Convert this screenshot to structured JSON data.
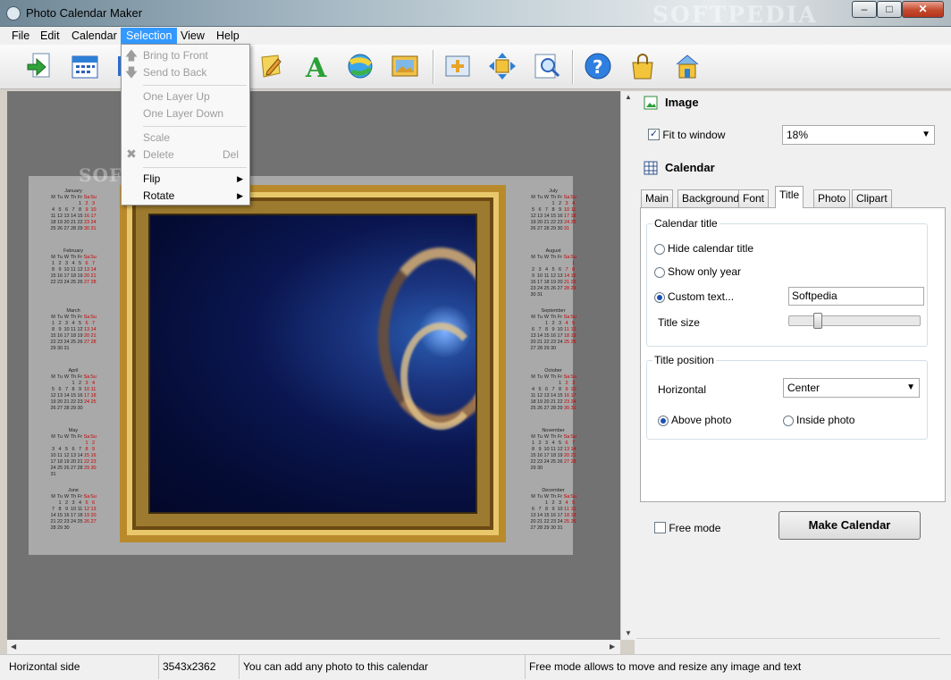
{
  "window": {
    "title": "Photo Calendar Maker",
    "watermark": "SOFTPEDIA",
    "buttons": {
      "min": "–",
      "max": "□",
      "close": "✕"
    }
  },
  "menu": [
    {
      "label": "File"
    },
    {
      "label": "Edit"
    },
    {
      "label": "Calendar"
    },
    {
      "label": "Selection",
      "active": true
    },
    {
      "label": "View"
    },
    {
      "label": "Help"
    }
  ],
  "selection_menu": {
    "items": [
      {
        "label": "Bring to Front",
        "enabled": false
      },
      {
        "label": "Send to Back",
        "enabled": false
      },
      {
        "label": "One Layer Up",
        "enabled": false
      },
      {
        "label": "One Layer Down",
        "enabled": false
      },
      {
        "label": "Scale",
        "enabled": false
      },
      {
        "label": "Delete",
        "enabled": false,
        "shortcut": "Del"
      },
      {
        "label": "Flip",
        "enabled": true,
        "submenu": true
      },
      {
        "label": "Rotate",
        "enabled": true,
        "submenu": true
      }
    ]
  },
  "toolbar": {
    "icons": [
      "open-photo-icon",
      "calendar-icon",
      "layout-icon",
      "note-icon",
      "text-icon",
      "ball-icon",
      "background-image-icon",
      "fit-icon",
      "move-icon",
      "zoom-icon",
      "help-icon",
      "buy-icon",
      "home-icon"
    ]
  },
  "canvas": {
    "watermark": "SOFTPEDIA",
    "months_left": [
      {
        "name": "January",
        "header": [
          "M",
          "Tu",
          "W",
          "Th",
          "Fr",
          "Sa",
          "Su"
        ],
        "weeks": [
          [
            "",
            "",
            "",
            "",
            "1",
            "2",
            "3"
          ],
          [
            "4",
            "5",
            "6",
            "7",
            "8",
            "9",
            "10"
          ],
          [
            "11",
            "12",
            "13",
            "14",
            "15",
            "16",
            "17"
          ],
          [
            "18",
            "19",
            "20",
            "21",
            "22",
            "23",
            "24"
          ],
          [
            "25",
            "26",
            "27",
            "28",
            "29",
            "30",
            "31"
          ]
        ]
      },
      {
        "name": "February",
        "header": [
          "M",
          "Tu",
          "W",
          "Th",
          "Fr",
          "Sa",
          "Su"
        ],
        "weeks": [
          [
            "1",
            "2",
            "3",
            "4",
            "5",
            "6",
            "7"
          ],
          [
            "8",
            "9",
            "10",
            "11",
            "12",
            "13",
            "14"
          ],
          [
            "15",
            "16",
            "17",
            "18",
            "19",
            "20",
            "21"
          ],
          [
            "22",
            "23",
            "24",
            "25",
            "26",
            "27",
            "28"
          ]
        ]
      },
      {
        "name": "March",
        "header": [
          "M",
          "Tu",
          "W",
          "Th",
          "Fr",
          "Sa",
          "Su"
        ],
        "weeks": [
          [
            "1",
            "2",
            "3",
            "4",
            "5",
            "6",
            "7"
          ],
          [
            "8",
            "9",
            "10",
            "11",
            "12",
            "13",
            "14"
          ],
          [
            "15",
            "16",
            "17",
            "18",
            "19",
            "20",
            "21"
          ],
          [
            "22",
            "23",
            "24",
            "25",
            "26",
            "27",
            "28"
          ],
          [
            "29",
            "30",
            "31",
            "",
            "",
            "",
            ""
          ]
        ]
      },
      {
        "name": "April",
        "header": [
          "M",
          "Tu",
          "W",
          "Th",
          "Fr",
          "Sa",
          "Su"
        ],
        "weeks": [
          [
            "",
            "",
            "",
            "1",
            "2",
            "3",
            "4"
          ],
          [
            "5",
            "6",
            "7",
            "8",
            "9",
            "10",
            "11"
          ],
          [
            "12",
            "13",
            "14",
            "15",
            "16",
            "17",
            "18"
          ],
          [
            "19",
            "20",
            "21",
            "22",
            "23",
            "24",
            "25"
          ],
          [
            "26",
            "27",
            "28",
            "29",
            "30",
            "",
            ""
          ]
        ]
      },
      {
        "name": "May",
        "header": [
          "M",
          "Tu",
          "W",
          "Th",
          "Fr",
          "Sa",
          "Su"
        ],
        "weeks": [
          [
            "",
            "",
            "",
            "",
            "",
            "1",
            "2"
          ],
          [
            "3",
            "4",
            "5",
            "6",
            "7",
            "8",
            "9"
          ],
          [
            "10",
            "11",
            "12",
            "13",
            "14",
            "15",
            "16"
          ],
          [
            "17",
            "18",
            "19",
            "20",
            "21",
            "22",
            "23"
          ],
          [
            "24",
            "25",
            "26",
            "27",
            "28",
            "29",
            "30"
          ],
          [
            "31",
            "",
            "",
            "",
            "",
            "",
            ""
          ]
        ]
      },
      {
        "name": "June",
        "header": [
          "M",
          "Tu",
          "W",
          "Th",
          "Fr",
          "Sa",
          "Su"
        ],
        "weeks": [
          [
            "",
            "1",
            "2",
            "3",
            "4",
            "5",
            "6"
          ],
          [
            "7",
            "8",
            "9",
            "10",
            "11",
            "12",
            "13"
          ],
          [
            "14",
            "15",
            "16",
            "17",
            "18",
            "19",
            "20"
          ],
          [
            "21",
            "22",
            "23",
            "24",
            "25",
            "26",
            "27"
          ],
          [
            "28",
            "29",
            "30",
            "",
            "",
            "",
            ""
          ]
        ]
      }
    ],
    "months_right": [
      {
        "name": "July",
        "header": [
          "M",
          "Tu",
          "W",
          "Th",
          "Fr",
          "Sa",
          "Su"
        ],
        "weeks": [
          [
            "",
            "",
            "",
            "1",
            "2",
            "3",
            "4"
          ],
          [
            "5",
            "6",
            "7",
            "8",
            "9",
            "10",
            "11"
          ],
          [
            "12",
            "13",
            "14",
            "15",
            "16",
            "17",
            "18"
          ],
          [
            "19",
            "20",
            "21",
            "22",
            "23",
            "24",
            "25"
          ],
          [
            "26",
            "27",
            "28",
            "29",
            "30",
            "31",
            ""
          ]
        ]
      },
      {
        "name": "August",
        "header": [
          "M",
          "Tu",
          "W",
          "Th",
          "Fr",
          "Sa",
          "Su"
        ],
        "weeks": [
          [
            "",
            "",
            "",
            "",
            "",
            "",
            "1"
          ],
          [
            "2",
            "3",
            "4",
            "5",
            "6",
            "7",
            "8"
          ],
          [
            "9",
            "10",
            "11",
            "12",
            "13",
            "14",
            "15"
          ],
          [
            "16",
            "17",
            "18",
            "19",
            "20",
            "21",
            "22"
          ],
          [
            "23",
            "24",
            "25",
            "26",
            "27",
            "28",
            "29"
          ],
          [
            "30",
            "31",
            "",
            "",
            "",
            "",
            ""
          ]
        ]
      },
      {
        "name": "September",
        "header": [
          "M",
          "Tu",
          "W",
          "Th",
          "Fr",
          "Sa",
          "Su"
        ],
        "weeks": [
          [
            "",
            "",
            "1",
            "2",
            "3",
            "4",
            "5"
          ],
          [
            "6",
            "7",
            "8",
            "9",
            "10",
            "11",
            "12"
          ],
          [
            "13",
            "14",
            "15",
            "16",
            "17",
            "18",
            "19"
          ],
          [
            "20",
            "21",
            "22",
            "23",
            "24",
            "25",
            "26"
          ],
          [
            "27",
            "28",
            "29",
            "30",
            "",
            "",
            ""
          ]
        ]
      },
      {
        "name": "October",
        "header": [
          "M",
          "Tu",
          "W",
          "Th",
          "Fr",
          "Sa",
          "Su"
        ],
        "weeks": [
          [
            "",
            "",
            "",
            "",
            "1",
            "2",
            "3"
          ],
          [
            "4",
            "5",
            "6",
            "7",
            "8",
            "9",
            "10"
          ],
          [
            "11",
            "12",
            "13",
            "14",
            "15",
            "16",
            "17"
          ],
          [
            "18",
            "19",
            "20",
            "21",
            "22",
            "23",
            "24"
          ],
          [
            "25",
            "26",
            "27",
            "28",
            "29",
            "30",
            "31"
          ]
        ]
      },
      {
        "name": "November",
        "header": [
          "M",
          "Tu",
          "W",
          "Th",
          "Fr",
          "Sa",
          "Su"
        ],
        "weeks": [
          [
            "1",
            "2",
            "3",
            "4",
            "5",
            "6",
            "7"
          ],
          [
            "8",
            "9",
            "10",
            "11",
            "12",
            "13",
            "14"
          ],
          [
            "15",
            "16",
            "17",
            "18",
            "19",
            "20",
            "21"
          ],
          [
            "22",
            "23",
            "24",
            "25",
            "26",
            "27",
            "28"
          ],
          [
            "29",
            "30",
            "",
            "",
            "",
            "",
            ""
          ]
        ]
      },
      {
        "name": "December",
        "header": [
          "M",
          "Tu",
          "W",
          "Th",
          "Fr",
          "Sa",
          "Su"
        ],
        "weeks": [
          [
            "",
            "",
            "1",
            "2",
            "3",
            "4",
            "5"
          ],
          [
            "6",
            "7",
            "8",
            "9",
            "10",
            "11",
            "12"
          ],
          [
            "13",
            "14",
            "15",
            "16",
            "17",
            "18",
            "19"
          ],
          [
            "20",
            "21",
            "22",
            "23",
            "24",
            "25",
            "26"
          ],
          [
            "27",
            "28",
            "29",
            "30",
            "31",
            "",
            ""
          ]
        ]
      }
    ]
  },
  "panel": {
    "image": {
      "header": "Image",
      "fit_label": "Fit to window",
      "fit_checked": true,
      "zoom": "18%"
    },
    "calendar": {
      "header": "Calendar",
      "tabs": [
        "Main",
        "Background",
        "Font",
        "Title",
        "Photo",
        "Clipart"
      ],
      "active_tab": "Title"
    },
    "title_tab": {
      "group_title": "Calendar title",
      "hide_label": "Hide calendar title",
      "year_label": "Show only year",
      "custom_label": "Custom text...",
      "custom_value": "Softpedia",
      "size_label": "Title size",
      "title_size_fraction": 0.2,
      "position_group": "Title position",
      "horizontal_label": "Horizontal",
      "horizontal_value": "Center",
      "above_label": "Above photo",
      "inside_label": "Inside photo"
    },
    "free_mode_label": "Free mode",
    "make_button": "Make Calendar"
  },
  "status": {
    "left": "Horizontal side",
    "size": "3543x2362",
    "hint": "You can add any photo to this calendar",
    "tip": "Free mode allows to move and resize any image and text"
  }
}
